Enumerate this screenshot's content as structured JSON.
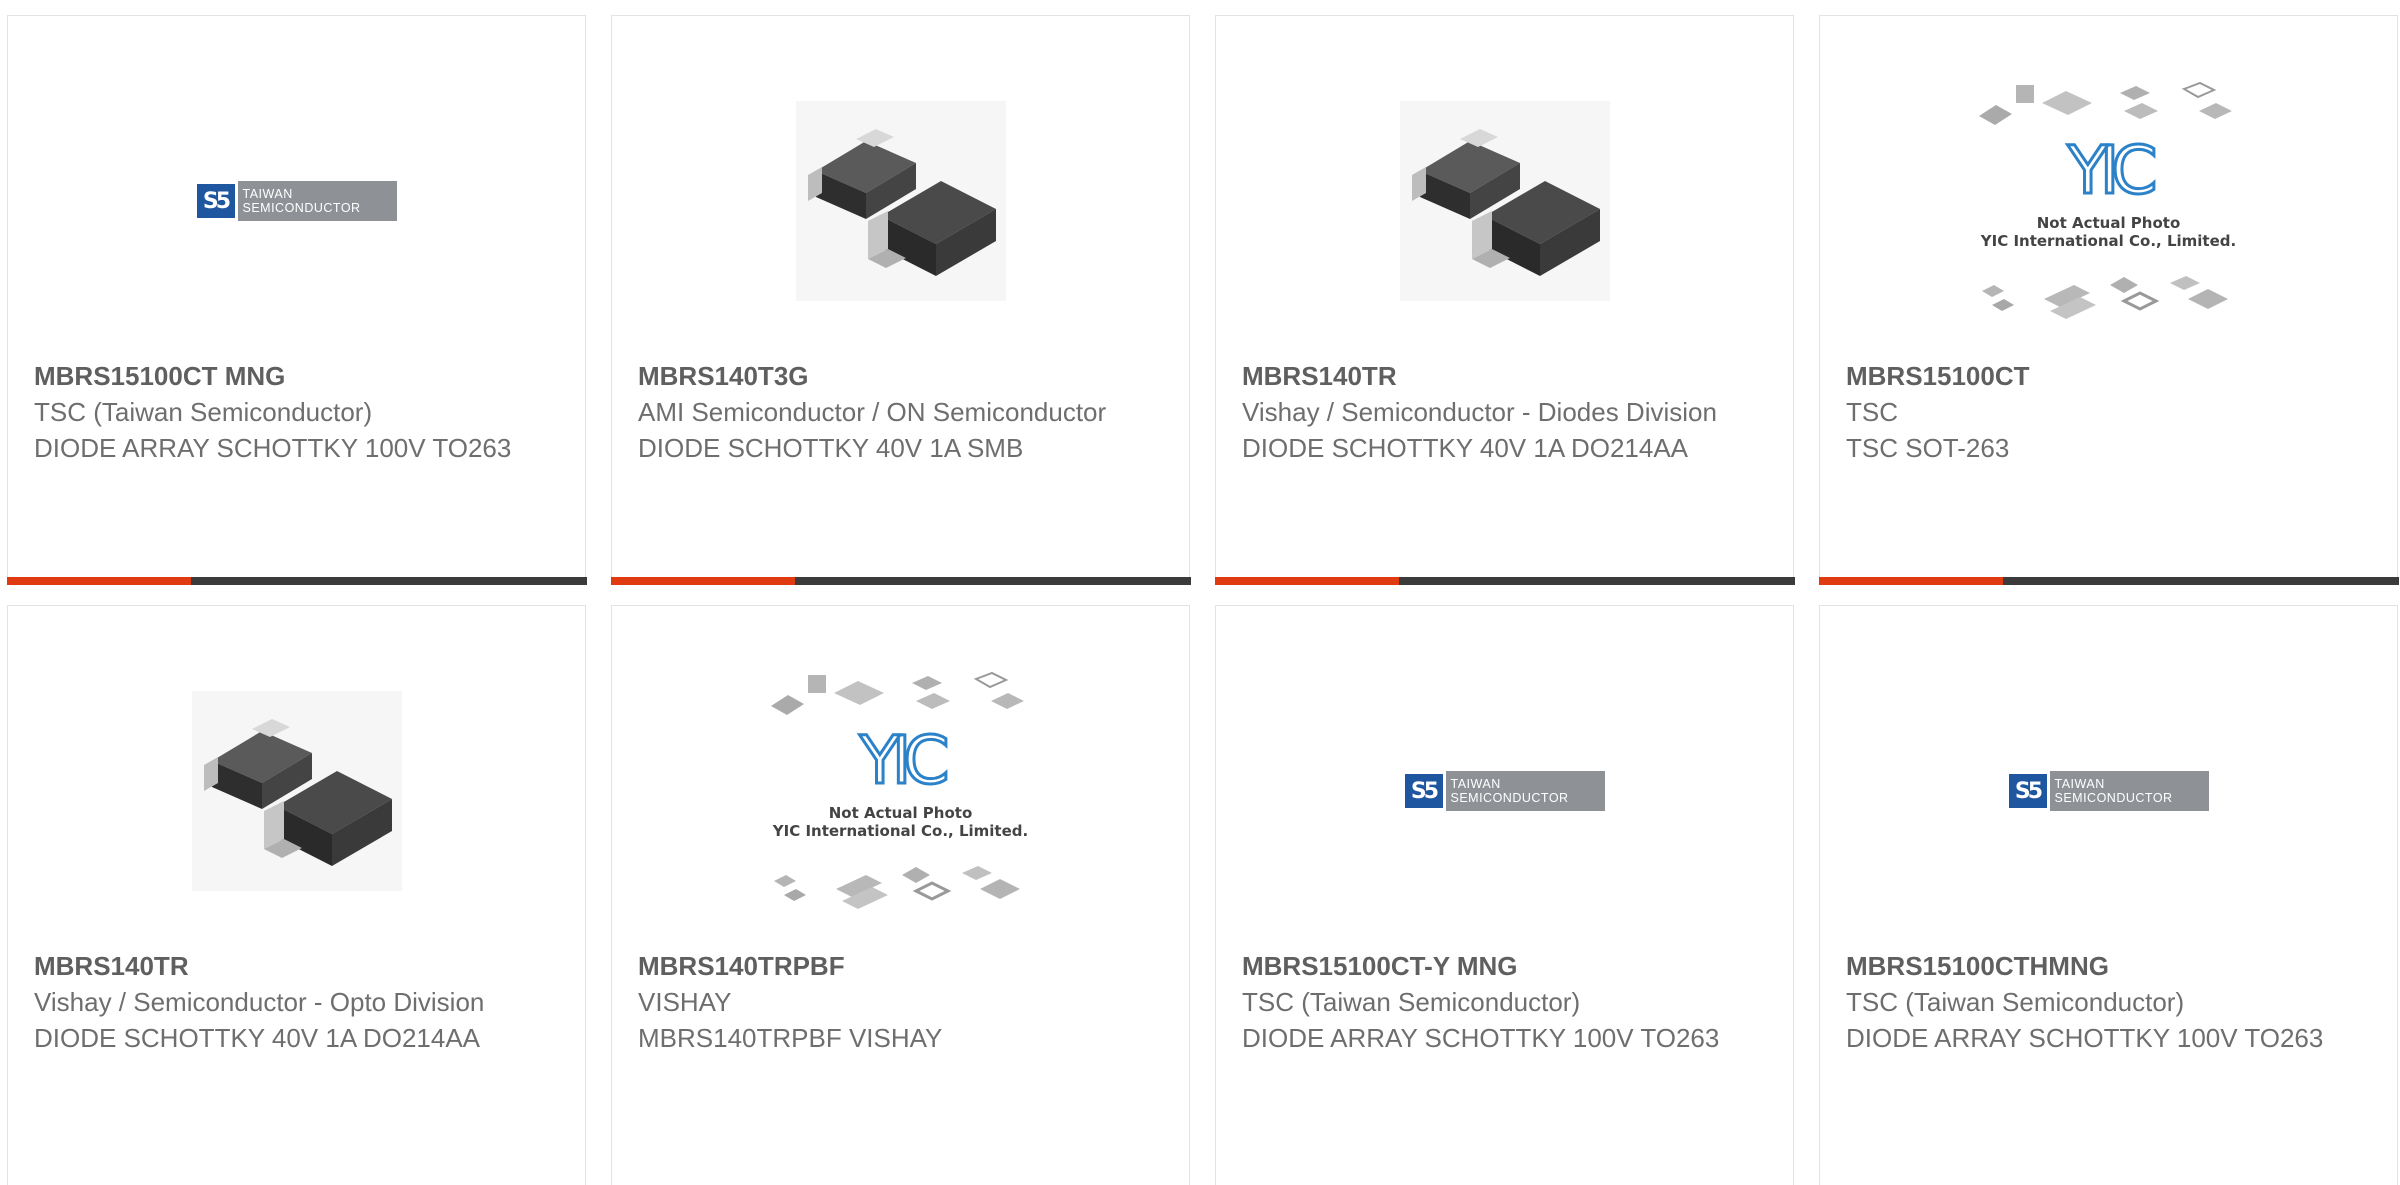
{
  "logo_text": {
    "tsc_mark": "S5",
    "tsc_line1": "TAIWAN",
    "tsc_line2": "SEMICONDUCTOR",
    "yic_mark": "YIC",
    "yic_caption1": "Not Actual Photo",
    "yic_caption2": "YIC International Co., Limited."
  },
  "products": [
    {
      "part_number": "MBRS15100CT MNG",
      "manufacturer": "TSC (Taiwan Semiconductor)",
      "description": "DIODE ARRAY SCHOTTKY 100V TO263",
      "image": "tsc-logo"
    },
    {
      "part_number": "MBRS140T3G",
      "manufacturer": "AMI Semiconductor / ON Semiconductor",
      "description": "DIODE SCHOTTKY 40V 1A SMB",
      "image": "smb-package-photo"
    },
    {
      "part_number": "MBRS140TR",
      "manufacturer": "Vishay / Semiconductor - Diodes Division",
      "description": "DIODE SCHOTTKY 40V 1A DO214AA",
      "image": "smb-package-photo"
    },
    {
      "part_number": "MBRS15100CT",
      "manufacturer": "TSC",
      "description": "TSC SOT-263",
      "image": "yic-placeholder"
    },
    {
      "part_number": "MBRS140TR",
      "manufacturer": "Vishay / Semiconductor - Opto Division",
      "description": "DIODE SCHOTTKY 40V 1A DO214AA",
      "image": "smb-package-photo"
    },
    {
      "part_number": "MBRS140TRPBF",
      "manufacturer": "VISHAY",
      "description": "MBRS140TRPBF VISHAY",
      "image": "yic-placeholder"
    },
    {
      "part_number": "MBRS15100CT-Y MNG",
      "manufacturer": "TSC (Taiwan Semiconductor)",
      "description": "DIODE ARRAY SCHOTTKY 100V TO263",
      "image": "tsc-logo"
    },
    {
      "part_number": "MBRS15100CTHMNG",
      "manufacturer": "TSC (Taiwan Semiconductor)",
      "description": "DIODE ARRAY SCHOTTKY 100V TO263",
      "image": "tsc-logo"
    }
  ],
  "colors": {
    "accent": "#e03b10",
    "bar": "#3b3b3b",
    "part_number": "#5f5f5f",
    "text": "#6e6e6e",
    "border": "#e3e3e3"
  }
}
